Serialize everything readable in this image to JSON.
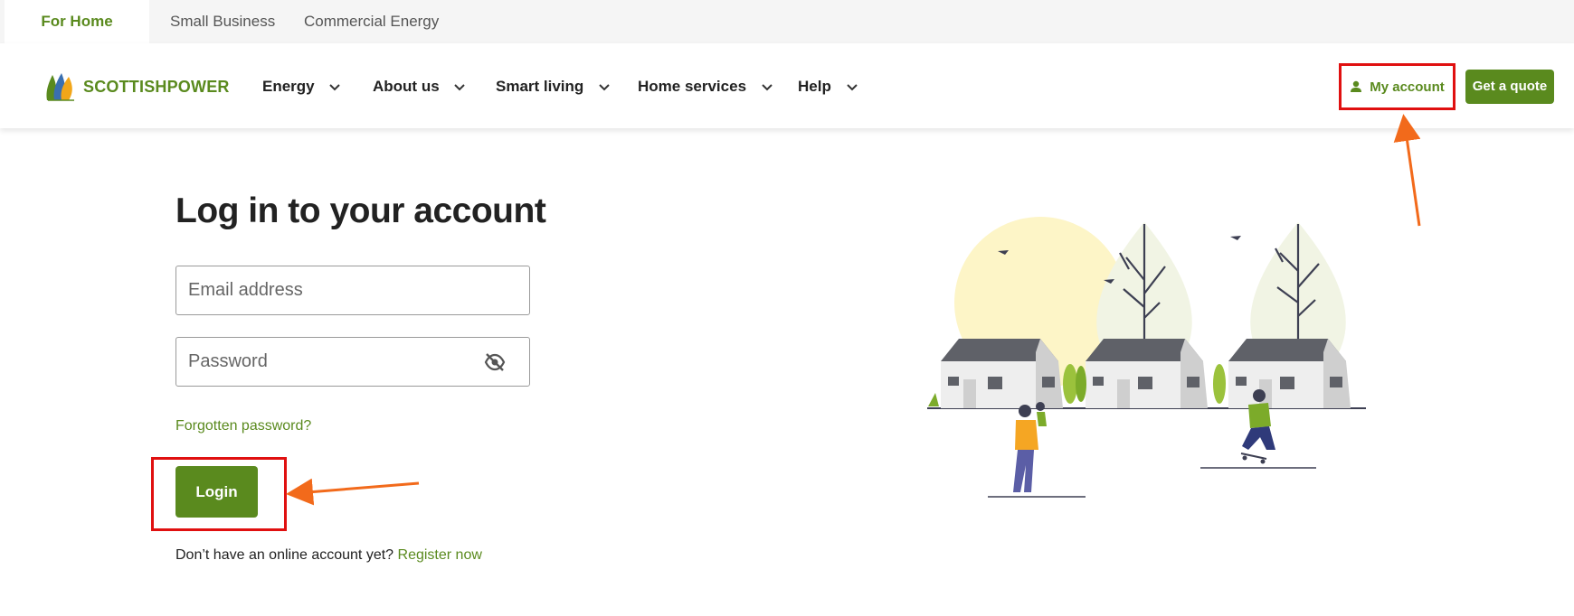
{
  "segments": [
    {
      "label": "For Home",
      "active": true
    },
    {
      "label": "Small Business",
      "active": false
    },
    {
      "label": "Commercial Energy",
      "active": false
    }
  ],
  "brand": {
    "name": "SCOTTISHPOWER",
    "color": "#5a8a1e"
  },
  "nav": {
    "items": [
      {
        "label": "Energy"
      },
      {
        "label": "About us"
      },
      {
        "label": "Smart living"
      },
      {
        "label": "Home services"
      },
      {
        "label": "Help"
      }
    ],
    "account_label": "My account",
    "quote_label": "Get a quote"
  },
  "login": {
    "title": "Log in to your account",
    "email_placeholder": "Email address",
    "email_value": "",
    "password_placeholder": "Password",
    "password_value": "",
    "forgot_label": "Forgotten password?",
    "login_label": "Login",
    "no_account_text": "Don’t have an online account yet?",
    "register_label": "Register now"
  },
  "icons": {
    "account": "person-icon",
    "password_toggle": "eye-slash-icon",
    "menu_expand": "chevron-down-icon"
  },
  "annotations": {
    "highlight_color": "#e01010",
    "arrow_color": "#f26a1b"
  }
}
